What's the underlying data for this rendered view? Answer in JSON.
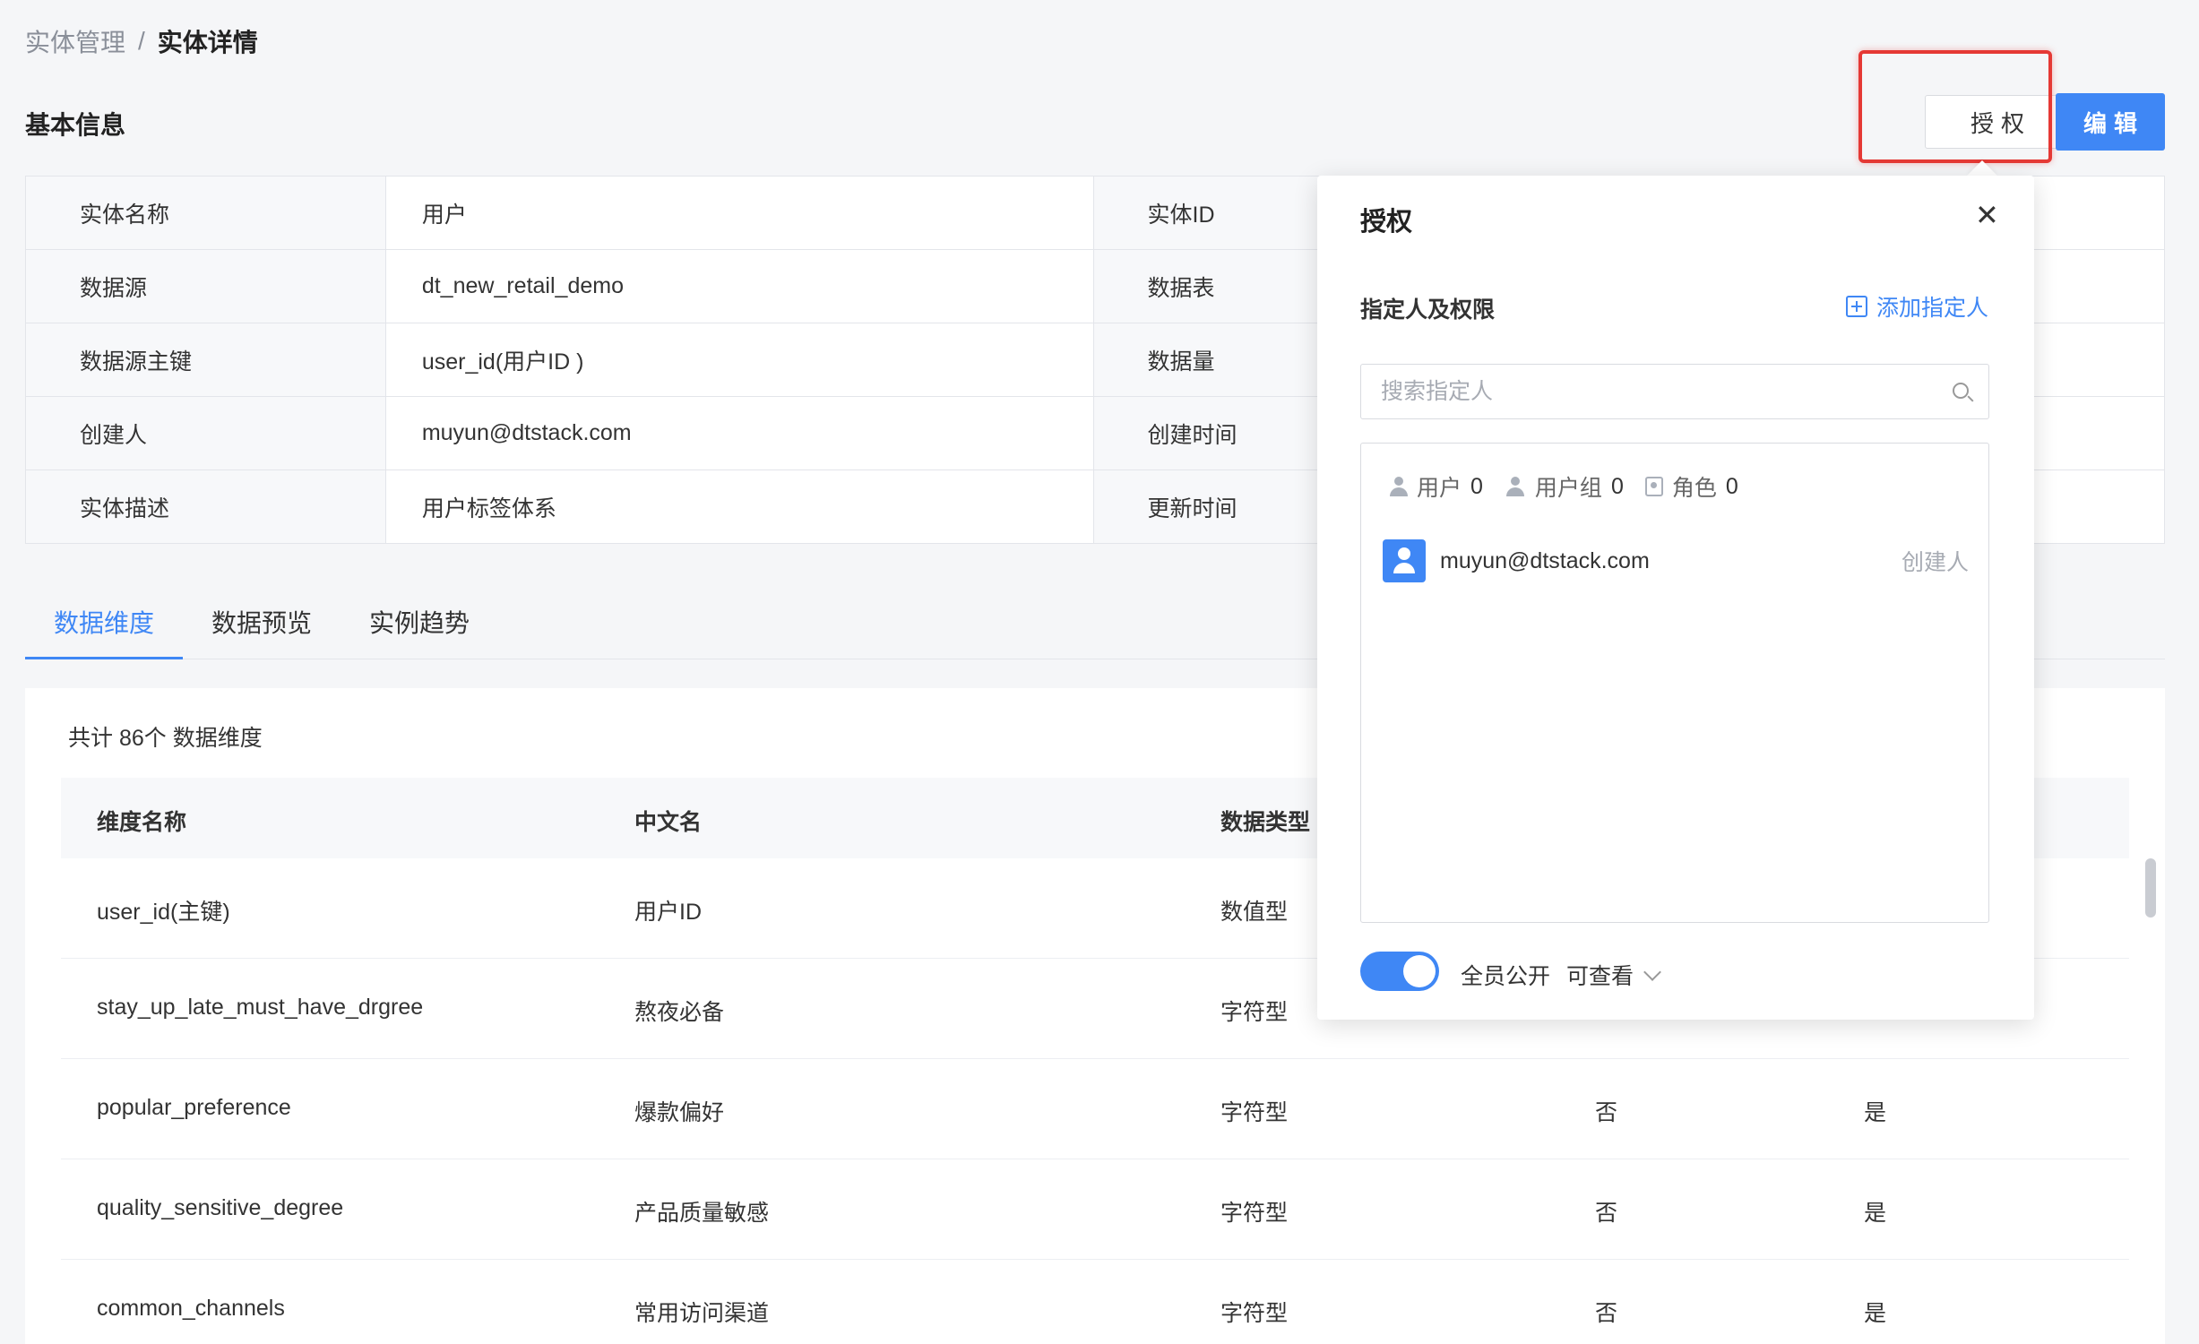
{
  "breadcrumb": {
    "parent": "实体管理",
    "separator": "/",
    "current": "实体详情"
  },
  "section": {
    "title": "基本信息"
  },
  "actions": {
    "auth_label": "授权",
    "edit_label": "编辑"
  },
  "info": {
    "rows": [
      {
        "l1": "实体名称",
        "v1": "用户",
        "l2": "实体ID",
        "v2": ""
      },
      {
        "l1": "数据源",
        "v1": "dt_new_retail_demo",
        "l2": "数据表",
        "v2": ""
      },
      {
        "l1": "数据源主键",
        "v1": "user_id(用户ID )",
        "l2": "数据量",
        "v2": ""
      },
      {
        "l1": "创建人",
        "v1": "muyun@dtstack.com",
        "l2": "创建时间",
        "v2": ""
      },
      {
        "l1": "实体描述",
        "v1": "用户标签体系",
        "l2": "更新时间",
        "v2": ""
      }
    ]
  },
  "tabs": [
    {
      "label": "数据维度",
      "active": true
    },
    {
      "label": "数据预览",
      "active": false
    },
    {
      "label": "实例趋势",
      "active": false
    }
  ],
  "dimensions": {
    "total_text": "共计 86个 数据维度",
    "headers": {
      "name": "维度名称",
      "cn": "中文名",
      "type": "数据类型"
    },
    "rows": [
      {
        "name": "user_id(主键)",
        "cn": "用户ID",
        "type": "数值型",
        "c4": "",
        "c5": ""
      },
      {
        "name": "stay_up_late_must_have_drgree",
        "cn": "熬夜必备",
        "type": "字符型",
        "c4": "",
        "c5": ""
      },
      {
        "name": "popular_preference",
        "cn": "爆款偏好",
        "type": "字符型",
        "c4": "否",
        "c5": "是"
      },
      {
        "name": "quality_sensitive_degree",
        "cn": "产品质量敏感",
        "type": "字符型",
        "c4": "否",
        "c5": "是"
      },
      {
        "name": "common_channels",
        "cn": "常用访问渠道",
        "type": "字符型",
        "c4": "否",
        "c5": "是"
      }
    ]
  },
  "popover": {
    "title": "授权",
    "close_icon": "close-icon",
    "subtitle": "指定人及权限",
    "add_label": "添加指定人",
    "search_placeholder": "搜索指定人",
    "counts": {
      "user_label": "用户",
      "user_count": "0",
      "group_label": "用户组",
      "group_count": "0",
      "role_label": "角色",
      "role_count": "0"
    },
    "members": [
      {
        "email": "muyun@dtstack.com",
        "role": "创建人"
      }
    ],
    "public_label": "全员公开",
    "permission": "可查看",
    "public_enabled": true
  },
  "colors": {
    "accent": "#3f87f5",
    "highlight": "#e53935"
  }
}
